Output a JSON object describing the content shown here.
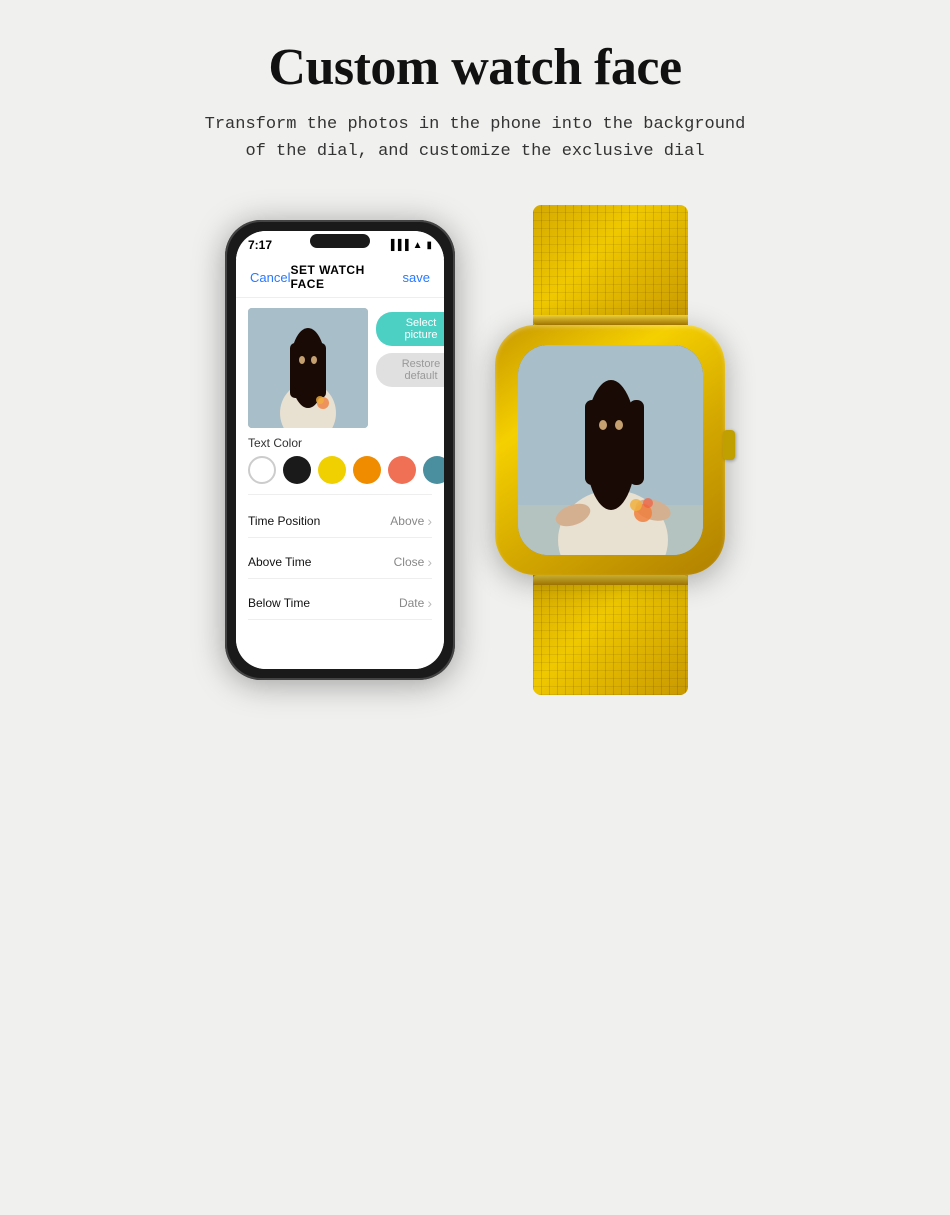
{
  "page": {
    "title": "Custom watch face",
    "subtitle_line1": "Transform the photos in the phone into the background",
    "subtitle_line2": "of the dial, and customize the exclusive dial"
  },
  "phone": {
    "time": "7:17",
    "header": {
      "cancel": "Cancel",
      "title": "SET WATCH FACE",
      "save": "save"
    },
    "buttons": {
      "select": "Select picture",
      "restore": "Restore default"
    },
    "text_color": {
      "label": "Text Color"
    },
    "menu_items": [
      {
        "label": "Time Position",
        "value": "Above"
      },
      {
        "label": "Above Time",
        "value": "Close"
      },
      {
        "label": "Below Time",
        "value": "Date"
      }
    ]
  },
  "colors": {
    "accent_blue": "#2979ff",
    "teal_button": "#4dd0c4",
    "swatches": [
      "#ffffff",
      "#1a1a1a",
      "#f0d000",
      "#f08c00",
      "#f07055",
      "#4a8fa0",
      "#1c35d4"
    ]
  }
}
